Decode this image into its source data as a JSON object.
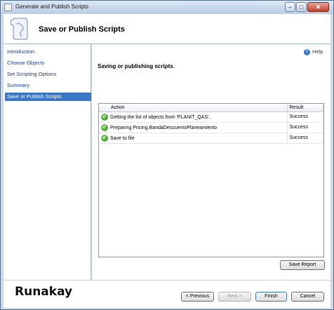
{
  "window": {
    "title": "Generate and Publish Scripts"
  },
  "header": {
    "title": "Save or Publish Scripts"
  },
  "nav": {
    "items": [
      {
        "label": "Introduction"
      },
      {
        "label": "Choose Objects"
      },
      {
        "label": "Set Scripting Options"
      },
      {
        "label": "Summary"
      },
      {
        "label": "Save or Publish Scripts",
        "active": true
      }
    ]
  },
  "main": {
    "help_label": "Help",
    "heading": "Saving or publishing scripts.",
    "grid": {
      "columns": [
        "Action",
        "Result"
      ],
      "rows": [
        {
          "action": "Getting the list of objects from 'PLANIT_QAS'.",
          "result": "Success"
        },
        {
          "action": "Preparing Pricing.BandaDescuentoPlaneamiento",
          "result": "Success"
        },
        {
          "action": "Save to file",
          "result": "Success"
        }
      ]
    },
    "save_report_label": "Save Report"
  },
  "footer": {
    "watermark": "Runakay",
    "previous_label": "< Previous",
    "next_label": "Next >",
    "finish_label": "Finish",
    "cancel_label": "Cancel"
  }
}
